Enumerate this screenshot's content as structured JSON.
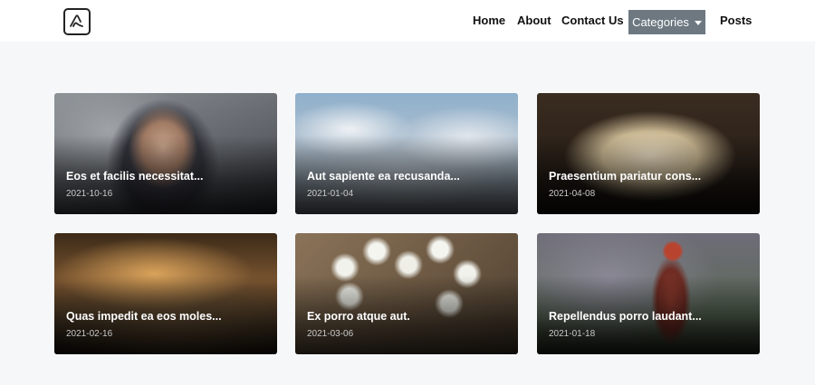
{
  "nav": {
    "home": "Home",
    "about": "About",
    "contact": "Contact Us",
    "categories": "Categories",
    "posts": "Posts"
  },
  "posts": [
    {
      "title": "Eos et facilis necessitat...",
      "date": "2021-10-16"
    },
    {
      "title": "Aut sapiente ea recusanda...",
      "date": "2021-01-04"
    },
    {
      "title": "Praesentium pariatur cons...",
      "date": "2021-04-08"
    },
    {
      "title": "Quas impedit ea eos moles...",
      "date": "2021-02-16"
    },
    {
      "title": "Ex porro atque aut.",
      "date": "2021-03-06"
    },
    {
      "title": "Repellendus porro laudant...",
      "date": "2021-01-18"
    }
  ],
  "colors": {
    "navbar_bg": "#ffffff",
    "page_bg": "#f6f7f9",
    "categories_bg": "#6d7881"
  }
}
